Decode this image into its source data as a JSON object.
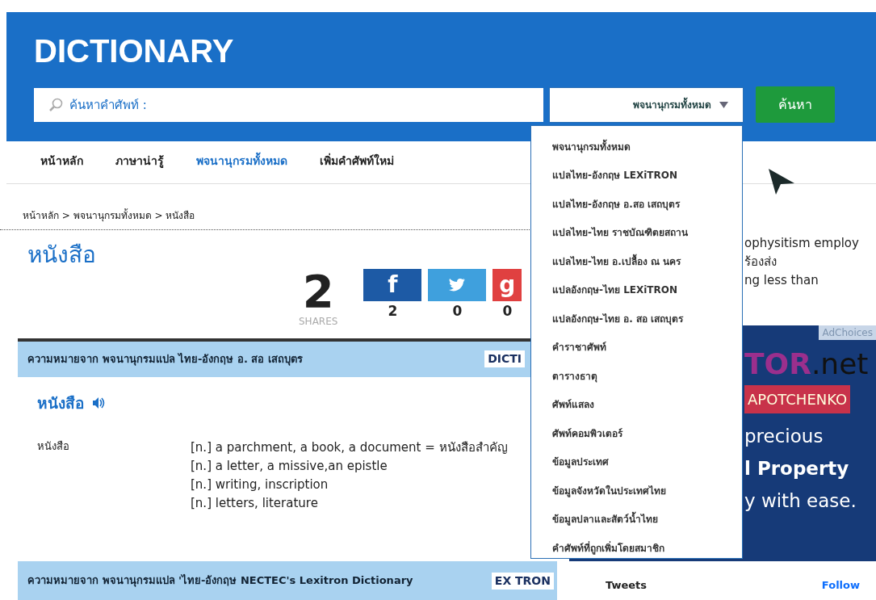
{
  "header": {
    "title": "DICTIONARY",
    "search": {
      "placeholder": "ค้นหาคำศัพท์ :"
    },
    "select": {
      "value": "พจนานุกรมทั้งหมด",
      "expanded": true
    },
    "button": "ค้นหา"
  },
  "nav": [
    {
      "label": "หน้าหลัก",
      "selected": false
    },
    {
      "label": "ภาษาน่ารู้",
      "selected": false
    },
    {
      "label": "พจนานุกรมทั้งหมด",
      "selected": true
    },
    {
      "label": "เพิ่มคำศัพท์ใหม่",
      "selected": false
    }
  ],
  "dropdown": [
    "พจนานุกรมทั้งหมด",
    "แปลไทย-อังกฤษ LEXiTRON",
    "แปลไทย-อังกฤษ อ.สอ เสถบุตร",
    "แปลไทย-ไทย ราชบัณฑิตยสถาน",
    "แปลไทย-ไทย อ.เปลื้อง ณ นคร",
    "แปลอังกฤษ-ไทย LEXiTRON",
    "แปลอังกฤษ-ไทย อ. สอ เสถบุตร",
    "คำราชาศัพท์",
    "ตารางธาตุ",
    "ศัพท์แสลง",
    "ศัพท์คอมพิวเตอร์",
    "ข้อมูลประเทศ",
    "ข้อมูลจังหวัดในประเทศไทย",
    "ข้อมูลปลาและสัตว์น้ำไทย",
    "คำศัพท์ที่ถูกเพิ่มโดยสมาชิก"
  ],
  "breadcrumb": "หน้าหลัก > พจนานุกรมทั้งหมด > หนังสือ",
  "word": "หนังสือ",
  "shares": {
    "count": "2",
    "label": "SHARES",
    "buttons": [
      {
        "kind": "facebook",
        "glyph": "f",
        "count": "2"
      },
      {
        "kind": "twitter",
        "count": "0"
      },
      {
        "kind": "google",
        "glyph": "g",
        "count": "0"
      }
    ]
  },
  "sections": [
    {
      "source": "ความหมายจาก พจนานุกรมแปล ไทย-อังกฤษ อ. สอ เสถบุตร",
      "logo": "DICTI",
      "headword": "หนังสือ",
      "entries": [
        {
          "term": "หนังสือ",
          "meanings": [
            "[n.] a parchment, a book, a document = หนังสือสำคัญ",
            "[n.] a letter, a missive,an epistle",
            "[n.] writing, inscription",
            "[n.] letters, literature"
          ]
        }
      ]
    },
    {
      "source": "ความหมายจาก พจนานุกรมแปล 'ไทย-อังกฤษ NECTEC's Lexitron Dictionary",
      "logo": "EX TRON"
    }
  ],
  "sidebar": {
    "lines": [
      "ophysitism  employ",
      "ร้องส่ง",
      "ng less than"
    ],
    "ad": {
      "badge": "AdChoices",
      "brand": "TOR",
      "brand_suffix": ".net",
      "banner": "APOTCHENKO",
      "lines": [
        "precious",
        "l Property",
        "y with ease."
      ]
    },
    "tweets": "Tweets",
    "follow": "Follow"
  }
}
